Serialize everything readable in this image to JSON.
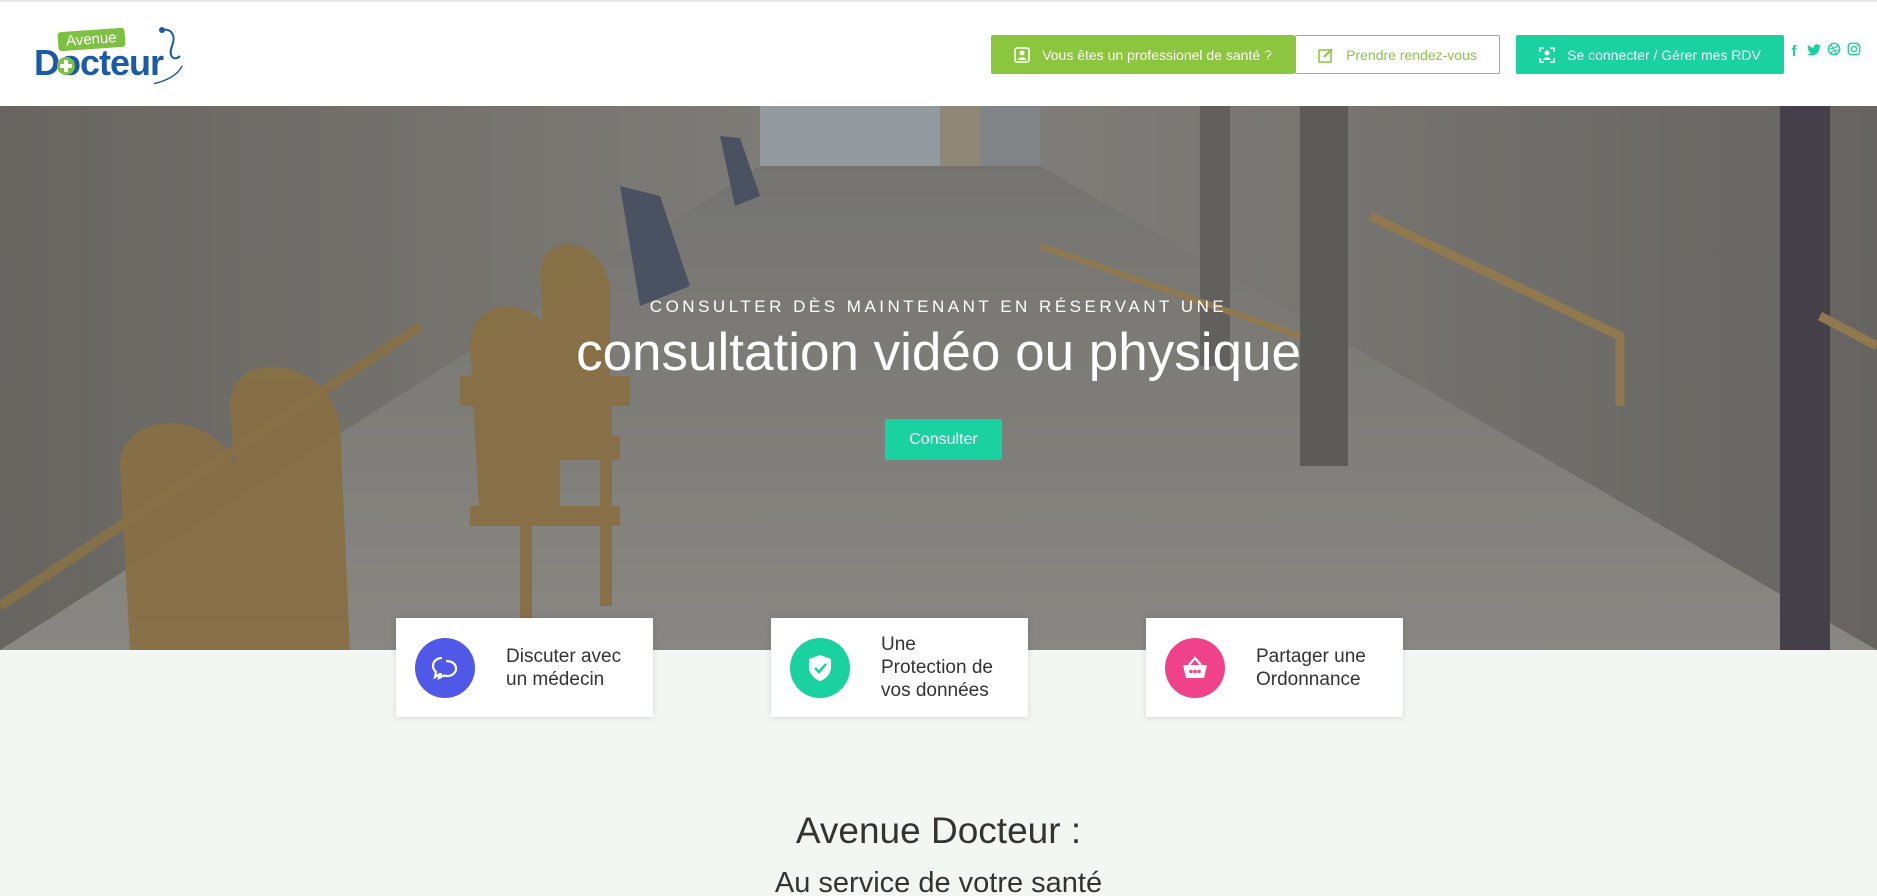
{
  "header": {
    "logo": {
      "top": "Avenue",
      "main": "Docteur"
    },
    "buttons": {
      "pro": "Vous êtes un professionel de santé ?",
      "rdv": "Prendre rendez-vous",
      "login": "Se connecter / Gérer mes RDV"
    },
    "social": [
      "facebook-icon",
      "twitter-icon",
      "dribbble-icon",
      "instagram-icon"
    ]
  },
  "hero": {
    "subtitle": "CONSULTER DÈS MAINTENANT EN RÉSERVANT UNE",
    "title": "consultation vidéo ou physique",
    "cta": "Consulter"
  },
  "features": [
    {
      "line1": "Discuter avec",
      "line2": "un médecin",
      "line3": "",
      "icon": "chat-icon",
      "color": "#5058e8"
    },
    {
      "line1": "Une",
      "line2": "Protection de",
      "line3": "vos données",
      "icon": "shield-icon",
      "color": "#1ad1a0"
    },
    {
      "line1": "Partager une",
      "line2": "Ordonnance",
      "line3": "",
      "icon": "basket-icon",
      "color": "#f0418b"
    }
  ],
  "section": {
    "title": "Avenue Docteur :",
    "subtitle": "Au service de votre santé"
  },
  "colors": {
    "green": "#8cc63f",
    "teal": "#1ad1a0",
    "brand_blue": "#1a5aa6"
  }
}
